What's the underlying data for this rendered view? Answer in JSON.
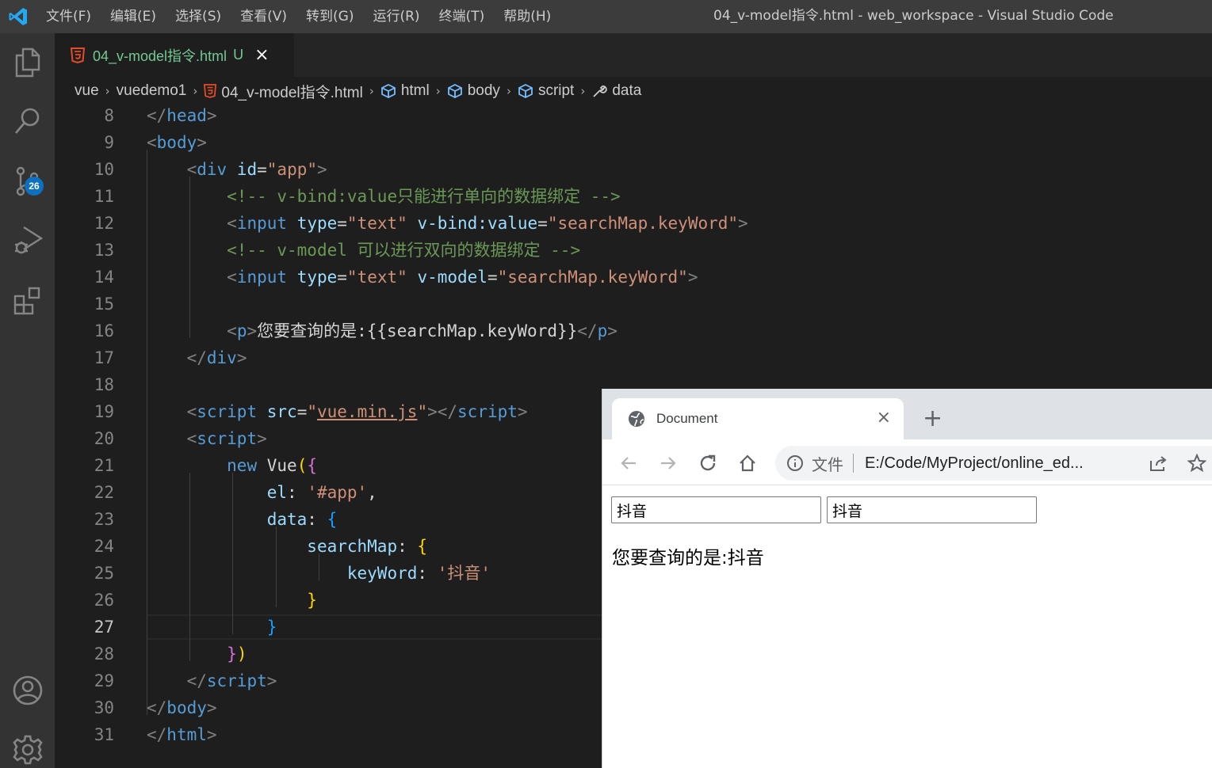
{
  "window": {
    "title": "04_v-model指令.html - web_workspace - Visual Studio Code",
    "menu": [
      "文件(F)",
      "编辑(E)",
      "选择(S)",
      "查看(V)",
      "转到(G)",
      "运行(R)",
      "终端(T)",
      "帮助(H)"
    ]
  },
  "activity": {
    "source_control_badge": "26",
    "icons": [
      "explorer-icon",
      "search-icon",
      "source-control-icon",
      "run-debug-icon",
      "extensions-icon",
      "account-icon",
      "settings-gear-icon"
    ]
  },
  "tab": {
    "filename": "04_v-model指令.html",
    "status": "U",
    "close": "×"
  },
  "breadcrumb": {
    "items": [
      "vue",
      "vuedemo1",
      "04_v-model指令.html",
      "html",
      "body",
      "script",
      "data"
    ]
  },
  "editor": {
    "active_line": 27,
    "lines": [
      {
        "n": "8",
        "t": [
          [
            "t-br",
            "</"
          ],
          [
            "t-tag",
            "head"
          ],
          [
            "t-br",
            ">"
          ]
        ]
      },
      {
        "n": "9",
        "t": [
          [
            "t-br",
            "<"
          ],
          [
            "t-tag",
            "body"
          ],
          [
            "t-br",
            ">"
          ]
        ]
      },
      {
        "n": "10",
        "t": [
          [
            "t-txt",
            "    "
          ],
          [
            "t-br",
            "<"
          ],
          [
            "t-tag",
            "div"
          ],
          [
            "t-txt",
            " "
          ],
          [
            "t-attr",
            "id"
          ],
          [
            "t-txt",
            "="
          ],
          [
            "t-str",
            "\"app\""
          ],
          [
            "t-br",
            ">"
          ]
        ]
      },
      {
        "n": "11",
        "t": [
          [
            "t-txt",
            "        "
          ],
          [
            "t-com",
            "<!-- v-bind:value只能进行单向的数据绑定 -->"
          ]
        ]
      },
      {
        "n": "12",
        "t": [
          [
            "t-txt",
            "        "
          ],
          [
            "t-br",
            "<"
          ],
          [
            "t-tag",
            "input"
          ],
          [
            "t-txt",
            " "
          ],
          [
            "t-attr",
            "type"
          ],
          [
            "t-txt",
            "="
          ],
          [
            "t-str",
            "\"text\""
          ],
          [
            "t-txt",
            " "
          ],
          [
            "t-attr",
            "v-bind:value"
          ],
          [
            "t-txt",
            "="
          ],
          [
            "t-str",
            "\"searchMap.keyWord\""
          ],
          [
            "t-br",
            ">"
          ]
        ]
      },
      {
        "n": "13",
        "t": [
          [
            "t-txt",
            "        "
          ],
          [
            "t-com",
            "<!-- v-model 可以进行双向的数据绑定 -->"
          ]
        ]
      },
      {
        "n": "14",
        "t": [
          [
            "t-txt",
            "        "
          ],
          [
            "t-br",
            "<"
          ],
          [
            "t-tag",
            "input"
          ],
          [
            "t-txt",
            " "
          ],
          [
            "t-attr",
            "type"
          ],
          [
            "t-txt",
            "="
          ],
          [
            "t-str",
            "\"text\""
          ],
          [
            "t-txt",
            " "
          ],
          [
            "t-attr",
            "v-model"
          ],
          [
            "t-txt",
            "="
          ],
          [
            "t-str",
            "\"searchMap.keyWord\""
          ],
          [
            "t-br",
            ">"
          ]
        ]
      },
      {
        "n": "15",
        "t": []
      },
      {
        "n": "16",
        "t": [
          [
            "t-txt",
            "        "
          ],
          [
            "t-br",
            "<"
          ],
          [
            "t-tag",
            "p"
          ],
          [
            "t-br",
            ">"
          ],
          [
            "t-txt",
            "您要查询的是:{{searchMap.keyWord}}"
          ],
          [
            "t-br",
            "</"
          ],
          [
            "t-tag",
            "p"
          ],
          [
            "t-br",
            ">"
          ]
        ]
      },
      {
        "n": "17",
        "t": [
          [
            "t-txt",
            "    "
          ],
          [
            "t-br",
            "</"
          ],
          [
            "t-tag",
            "div"
          ],
          [
            "t-br",
            ">"
          ]
        ]
      },
      {
        "n": "18",
        "t": []
      },
      {
        "n": "19",
        "t": [
          [
            "t-txt",
            "    "
          ],
          [
            "t-br",
            "<"
          ],
          [
            "t-tag",
            "script"
          ],
          [
            "t-txt",
            " "
          ],
          [
            "t-attr",
            "src"
          ],
          [
            "t-txt",
            "="
          ],
          [
            "t-str",
            "\""
          ],
          [
            "t-link",
            "vue.min.js"
          ],
          [
            "t-str",
            "\""
          ],
          [
            "t-br",
            "></"
          ],
          [
            "t-tag",
            "script"
          ],
          [
            "t-br",
            ">"
          ]
        ]
      },
      {
        "n": "20",
        "t": [
          [
            "t-txt",
            "    "
          ],
          [
            "t-br",
            "<"
          ],
          [
            "t-tag",
            "script"
          ],
          [
            "t-br",
            ">"
          ]
        ]
      },
      {
        "n": "21",
        "t": [
          [
            "t-txt",
            "        "
          ],
          [
            "t-tag",
            "new"
          ],
          [
            "t-txt",
            " "
          ],
          [
            "t-fn",
            "Vue"
          ],
          [
            "t-b1",
            "("
          ],
          [
            "t-b2",
            "{"
          ]
        ]
      },
      {
        "n": "22",
        "t": [
          [
            "t-txt",
            "            "
          ],
          [
            "t-attr",
            "el"
          ],
          [
            "t-txt",
            ": "
          ],
          [
            "t-str",
            "'#app'"
          ],
          [
            "t-txt",
            ","
          ]
        ]
      },
      {
        "n": "23",
        "t": [
          [
            "t-txt",
            "            "
          ],
          [
            "t-attr",
            "data"
          ],
          [
            "t-txt",
            ": "
          ],
          [
            "t-b3",
            "{"
          ]
        ]
      },
      {
        "n": "24",
        "t": [
          [
            "t-txt",
            "                "
          ],
          [
            "t-attr",
            "searchMap"
          ],
          [
            "t-txt",
            ": "
          ],
          [
            "t-b1",
            "{"
          ]
        ]
      },
      {
        "n": "25",
        "t": [
          [
            "t-txt",
            "                    "
          ],
          [
            "t-attr",
            "keyWord"
          ],
          [
            "t-txt",
            ": "
          ],
          [
            "t-str",
            "'抖音'"
          ]
        ]
      },
      {
        "n": "26",
        "t": [
          [
            "t-txt",
            "                "
          ],
          [
            "t-b1",
            "}"
          ]
        ]
      },
      {
        "n": "27",
        "t": [
          [
            "t-txt",
            "            "
          ],
          [
            "t-b3",
            "}"
          ]
        ]
      },
      {
        "n": "28",
        "t": [
          [
            "t-txt",
            "        "
          ],
          [
            "t-b2",
            "}"
          ],
          [
            "t-b1",
            ")"
          ]
        ]
      },
      {
        "n": "29",
        "t": [
          [
            "t-txt",
            "    "
          ],
          [
            "t-br",
            "</"
          ],
          [
            "t-tag",
            "script"
          ],
          [
            "t-br",
            ">"
          ]
        ]
      },
      {
        "n": "30",
        "t": [
          [
            "t-br",
            "</"
          ],
          [
            "t-tag",
            "body"
          ],
          [
            "t-br",
            ">"
          ]
        ]
      },
      {
        "n": "31",
        "t": [
          [
            "t-br",
            "</"
          ],
          [
            "t-tag",
            "html"
          ],
          [
            "t-br",
            ">"
          ]
        ]
      }
    ]
  },
  "browser": {
    "tab_title": "Document",
    "tab_close": "×",
    "new_tab": "+",
    "omnibox_label": "文件",
    "url": "E:/Code/MyProject/online_ed...",
    "input1_value": "抖音",
    "input2_value": "抖音",
    "paragraph": "您要查询的是:抖音"
  },
  "colors": {
    "accent": "#0e70c0",
    "editor_bg": "#1e1e1e",
    "tab_modified": "#73c991"
  }
}
